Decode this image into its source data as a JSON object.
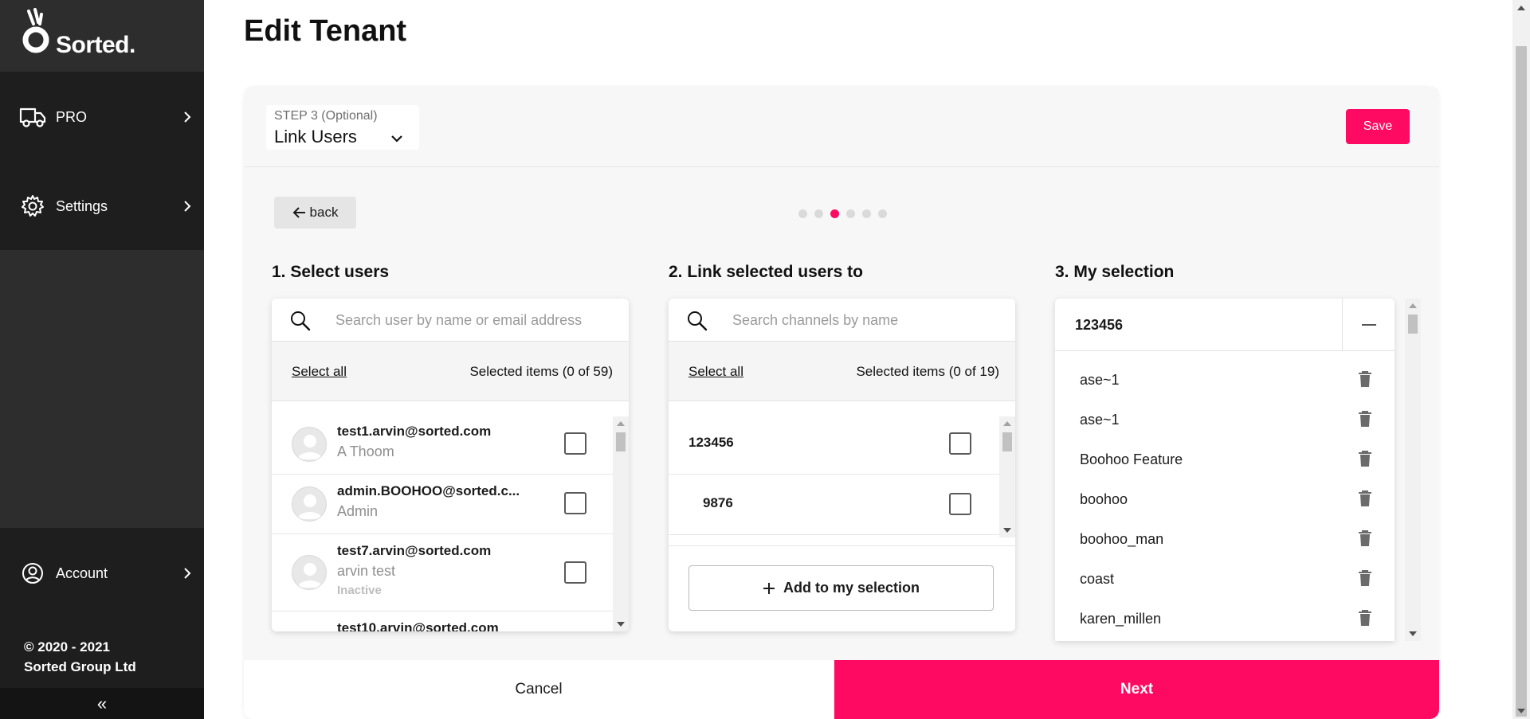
{
  "brand": {
    "name": "Sorted.",
    "accent_color": "#ff0a62"
  },
  "sidebar": {
    "items": [
      {
        "label": "PRO",
        "icon": "truck-icon"
      },
      {
        "label": "Settings",
        "icon": "gear-icon"
      }
    ],
    "account": {
      "label": "Account",
      "icon": "user-circle-icon"
    },
    "copyright_line1": "© 2020 - 2021",
    "copyright_line2": "Sorted Group Ltd",
    "collapse_glyph": "«"
  },
  "page": {
    "title": "Edit Tenant"
  },
  "step": {
    "small": "STEP 3 (Optional)",
    "main": "Link Users"
  },
  "toolbar": {
    "save_label": "Save",
    "back_label": "back"
  },
  "progress": {
    "total_steps": 6,
    "current_step": 3
  },
  "users_panel": {
    "title": "1. Select users",
    "search_placeholder": "Search user by name or email address",
    "select_all": "Select all",
    "selected_count": "Selected items (0 of 59)",
    "users": [
      {
        "email": "test1.arvin@sorted.com",
        "name": "A Thoom",
        "status": ""
      },
      {
        "email": "admin.BOOHOO@sorted.c...",
        "name": "Admin",
        "status": ""
      },
      {
        "email": "test7.arvin@sorted.com",
        "name": "arvin test",
        "status": "Inactive"
      },
      {
        "email": "test10.arvin@sorted.com",
        "name": "",
        "status": ""
      }
    ]
  },
  "channels_panel": {
    "title": "2. Link selected users to",
    "search_placeholder": "Search channels by name",
    "select_all": "Select all",
    "selected_count": "Selected items (0 of 19)",
    "channels": [
      {
        "label": "123456"
      },
      {
        "label": "9876"
      }
    ],
    "add_label": "Add to my selection"
  },
  "selection_panel": {
    "title": "3. My selection",
    "group": "123456",
    "items": [
      "ase~1",
      "ase~1",
      "Boohoo Feature",
      "boohoo",
      "boohoo_man",
      "coast",
      "karen_millen"
    ]
  },
  "footer": {
    "cancel_label": "Cancel",
    "next_label": "Next"
  }
}
